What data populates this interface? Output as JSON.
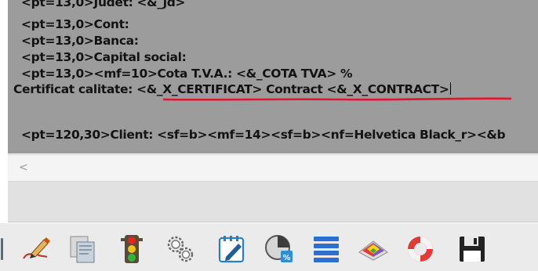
{
  "editor": {
    "lines": [
      "<pt=13,0>Judet: <&_jd>",
      "<pt=13,0>Cont:",
      "<pt=13,0>Banca:",
      "<pt=13,0>Capital social:",
      "<pt=13,0><mf=10>Cota T.V.A.: <&_COTA TVA> %",
      "Certificat calitate: <&_X_CERTIFICAT> Contract <&_X_CONTRACT>",
      "<pt=120,30>Client: <sf=b><mf=14><sf=b><nf=Helvetica Black_r><&b"
    ],
    "highlight_color": "#e3152b"
  },
  "scrollbar": {
    "left_arrow": "<"
  },
  "toolbar": {
    "icons": [
      "edit-pen-icon",
      "copy-pages-icon",
      "traffic-light-icon",
      "settings-gears-icon",
      "notepad-edit-icon",
      "pie-chart-percent-icon",
      "list-lines-icon",
      "color-palette-icon",
      "lifebuoy-icon",
      "save-floppy-icon"
    ]
  }
}
